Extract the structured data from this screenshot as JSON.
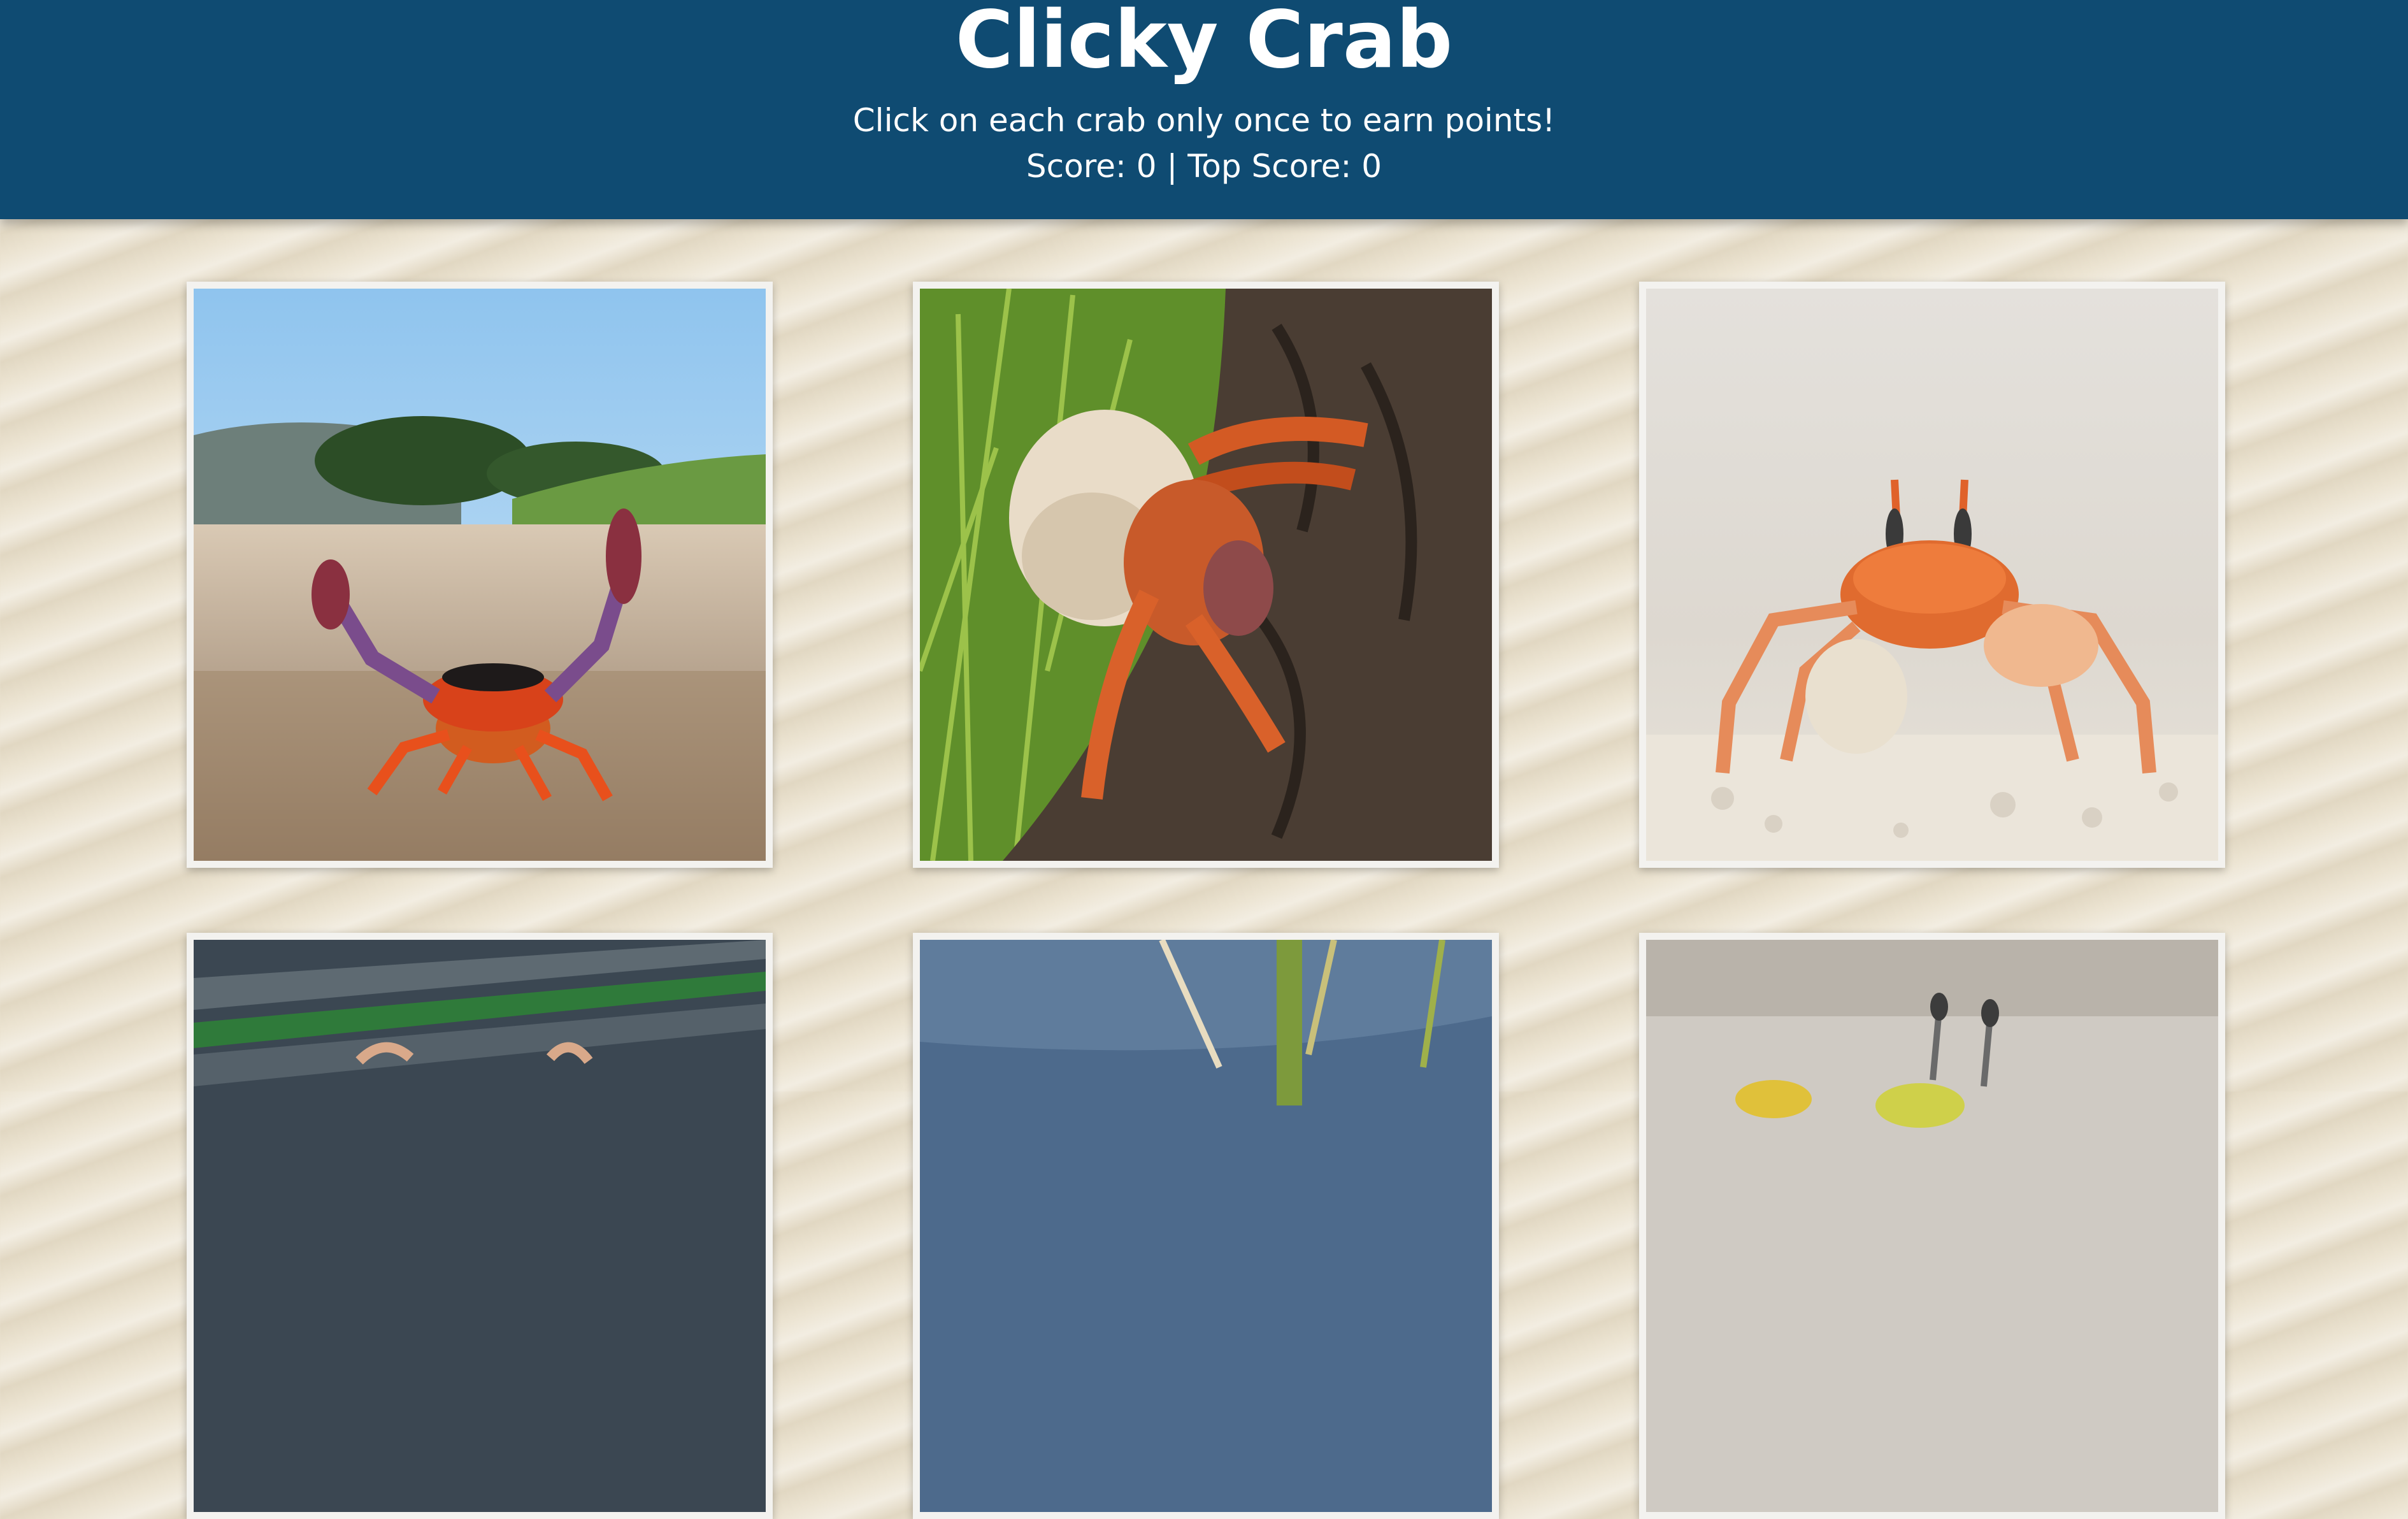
{
  "header": {
    "title": "Clicky Crab",
    "instructions": "Click on each crab only once to earn points!",
    "score_label": "Score:",
    "score": 0,
    "separator": "|",
    "top_score_label": "Top Score:",
    "top_score": 0
  },
  "cards": [
    {
      "name": "red-land-crab-on-beach"
    },
    {
      "name": "hermit-crab-on-bark"
    },
    {
      "name": "ghost-crab-on-sand"
    },
    {
      "name": "crab-on-wooden-planks"
    },
    {
      "name": "crab-near-grass-and-water"
    },
    {
      "name": "crab-with-eyestalks"
    }
  ],
  "colors": {
    "header_bg": "#0f4b72",
    "header_text": "#ffffff",
    "page_bg": "#ece4d2",
    "card_frame": "#f3f2ef"
  }
}
